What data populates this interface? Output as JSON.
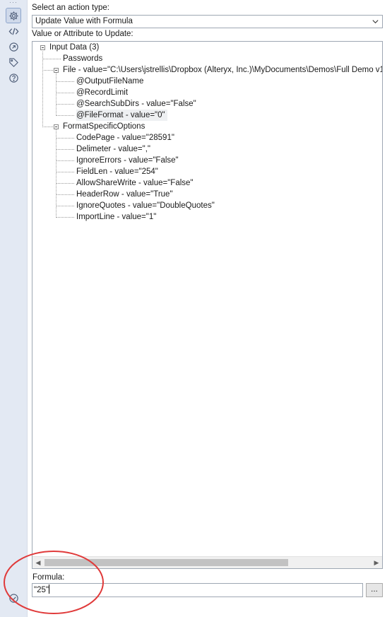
{
  "action": {
    "label": "Select an action type:",
    "selected": "Update Value with Formula"
  },
  "value_attr_label": "Value or Attribute to Update:",
  "tree": {
    "root": "Input Data (3)",
    "passwords": "Passwords",
    "file": "File - value=\"C:\\Users\\jstrellis\\Dropbox (Alteryx, Inc.)\\MyDocuments\\Demos\\Full Demo v1",
    "file_children": [
      "@OutputFileName",
      "@RecordLimit",
      "@SearchSubDirs - value=\"False\"",
      "@FileFormat - value=\"0\""
    ],
    "format_options": "FormatSpecificOptions",
    "format_children": [
      "CodePage - value=\"28591\"",
      "Delimeter - value=\",\"",
      "IgnoreErrors - value=\"False\"",
      "FieldLen - value=\"254\"",
      "AllowShareWrite - value=\"False\"",
      "HeaderRow - value=\"True\"",
      "IgnoreQuotes - value=\"DoubleQuotes\"",
      "ImportLine - value=\"1\""
    ]
  },
  "formula": {
    "label": "Formula:",
    "value": "\"25\"",
    "browse_label": "..."
  },
  "rail_icons": [
    "gear-icon",
    "code-icon",
    "navigate-icon",
    "tag-icon",
    "help-icon",
    "check-icon"
  ],
  "colors": {
    "rail_bg": "#e3e9f3",
    "icon": "#4e5d78",
    "annotation": "#e03a3a"
  }
}
